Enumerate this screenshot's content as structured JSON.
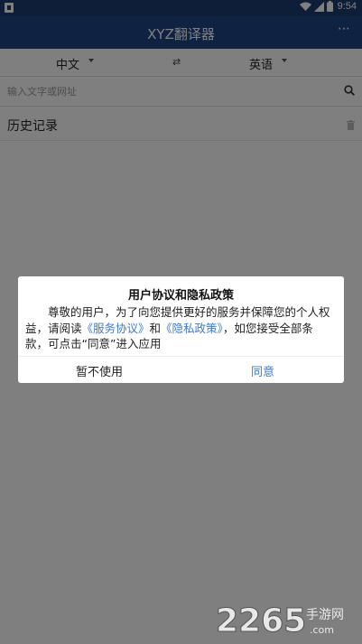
{
  "status_bar": {
    "time": "9:54"
  },
  "app_bar": {
    "title": "XYZ翻译器",
    "more_label": "⋯"
  },
  "language": {
    "source": "中文",
    "target": "英语",
    "swap_symbol": "⇄"
  },
  "search": {
    "placeholder": "输入文字或网址"
  },
  "history": {
    "title": "历史记录"
  },
  "dialog": {
    "title": "用户协议和隐私政策",
    "body_part1": "尊敬的用户，为了向您提供更好的服务并保障您的个人权益，请阅读",
    "link_service": "《服务协议》",
    "body_and": "和",
    "link_privacy": "《隐私政策》",
    "body_part2": "，如您接受全部条款，可点击“同意”进入应用",
    "cancel_label": "暂不使用",
    "agree_label": "同意"
  },
  "watermark": {
    "number": "2265",
    "suffix": "手游网",
    "domain": ".com"
  },
  "colors": {
    "status_bar": "#1c3d73",
    "app_bar": "#1e4485",
    "link": "#3a7bd5"
  }
}
